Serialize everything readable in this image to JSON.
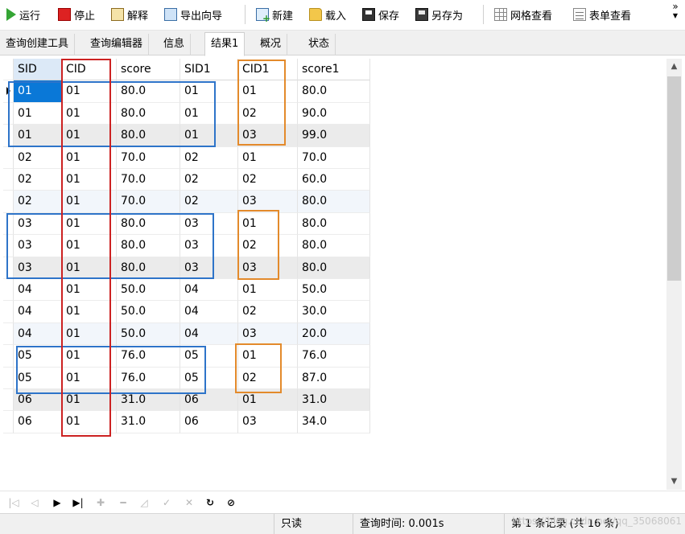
{
  "toolbar": {
    "run": "运行",
    "stop": "停止",
    "explain": "解释",
    "export_wizard": "导出向导",
    "new": "新建",
    "load": "载入",
    "save": "保存",
    "save_as": "另存为",
    "grid_view": "网格查看",
    "form_view": "表单查看",
    "more": "»"
  },
  "tabs": [
    "查询创建工具",
    "查询编辑器",
    "信息",
    "结果1",
    "概况",
    "状态"
  ],
  "active_tab": "结果1",
  "table": {
    "columns": [
      "SID",
      "CID",
      "score",
      "SID1",
      "CID1",
      "score1"
    ],
    "rows": [
      [
        "01",
        "01",
        "80.0",
        "01",
        "01",
        "80.0"
      ],
      [
        "01",
        "01",
        "80.0",
        "01",
        "02",
        "90.0"
      ],
      [
        "01",
        "01",
        "80.0",
        "01",
        "03",
        "99.0"
      ],
      [
        "02",
        "01",
        "70.0",
        "02",
        "01",
        "70.0"
      ],
      [
        "02",
        "01",
        "70.0",
        "02",
        "02",
        "60.0"
      ],
      [
        "02",
        "01",
        "70.0",
        "02",
        "03",
        "80.0"
      ],
      [
        "03",
        "01",
        "80.0",
        "03",
        "01",
        "80.0"
      ],
      [
        "03",
        "01",
        "80.0",
        "03",
        "02",
        "80.0"
      ],
      [
        "03",
        "01",
        "80.0",
        "03",
        "03",
        "80.0"
      ],
      [
        "04",
        "01",
        "50.0",
        "04",
        "01",
        "50.0"
      ],
      [
        "04",
        "01",
        "50.0",
        "04",
        "02",
        "30.0"
      ],
      [
        "04",
        "01",
        "50.0",
        "04",
        "03",
        "20.0"
      ],
      [
        "05",
        "01",
        "76.0",
        "05",
        "01",
        "76.0"
      ],
      [
        "05",
        "01",
        "76.0",
        "05",
        "02",
        "87.0"
      ],
      [
        "06",
        "01",
        "31.0",
        "06",
        "01",
        "31.0"
      ],
      [
        "06",
        "01",
        "31.0",
        "06",
        "03",
        "34.0"
      ]
    ]
  },
  "navigator": {
    "first": "|◁",
    "prev": "◁",
    "next": "▶",
    "last": "▶|",
    "add": "✚",
    "delete": "━",
    "edit": "◿",
    "apply": "✓",
    "cancel": "✕",
    "refresh": "↻",
    "stop": "⊘"
  },
  "status": {
    "readonly": "只读",
    "query_time": "查询时间: 0.001s",
    "record": "第 1 条记录 (共 16 条)",
    "watermark": "https://blog.csdn.net/qq_35068061"
  },
  "colors": {
    "selection": "#0a78d7",
    "annot_blue": "#2e74c9",
    "annot_orange": "#e38a2b",
    "annot_red": "#cc2222"
  }
}
